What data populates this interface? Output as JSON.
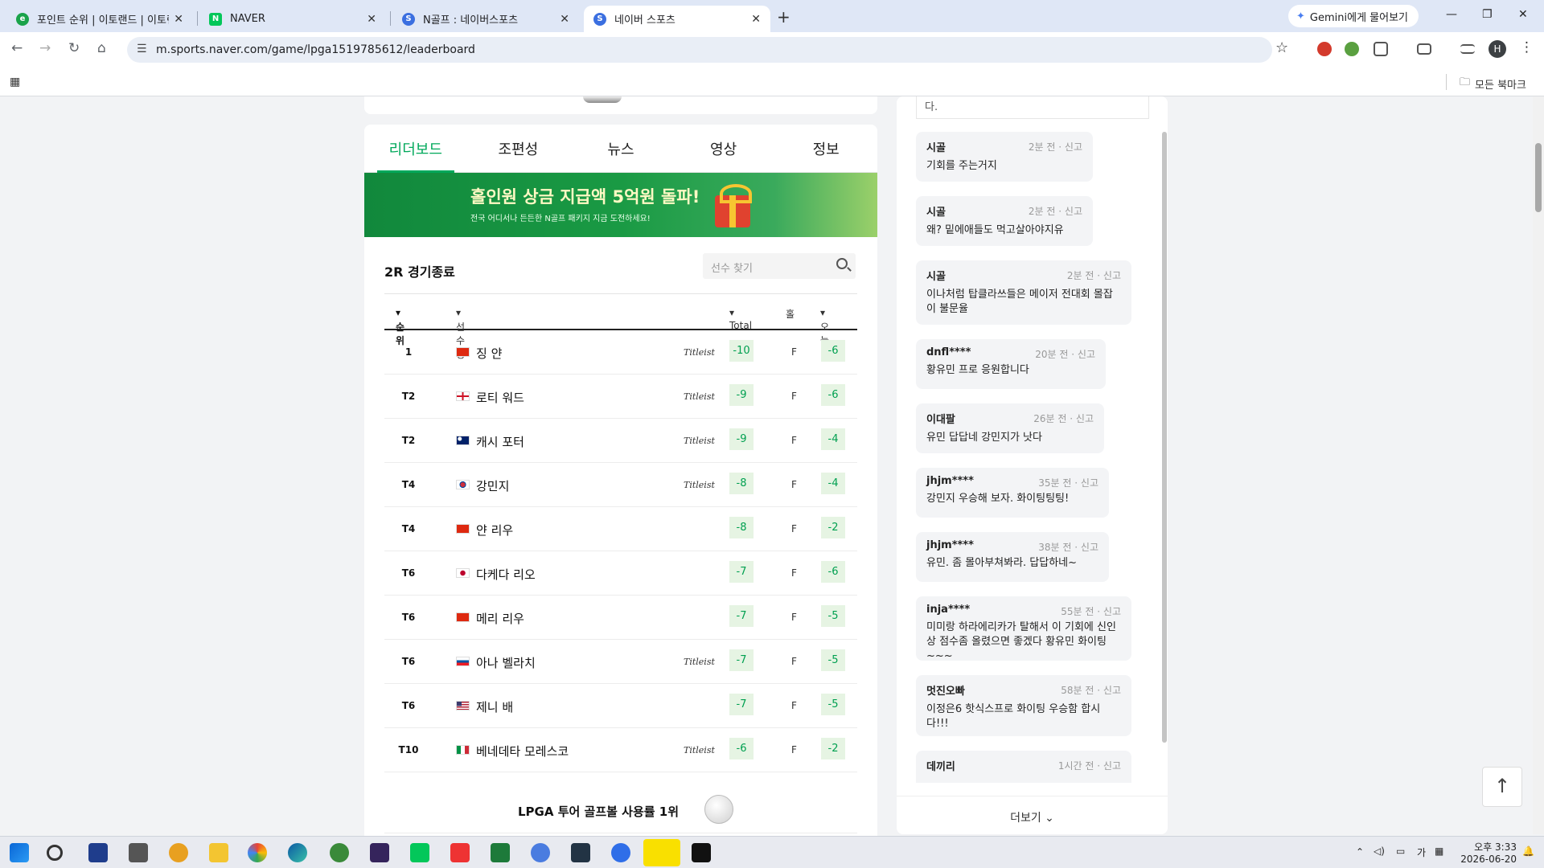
{
  "browser": {
    "tabs": [
      {
        "title": "포인트 순위 | 이토랜드 | 이토랜",
        "active": false,
        "color": "#1aa34a",
        "glyph": "e"
      },
      {
        "title": "NAVER",
        "active": false,
        "color": "#03c75a",
        "glyph": "N"
      },
      {
        "title": "N골프 : 네이버스포츠",
        "active": false,
        "color": "#3b6fe0",
        "glyph": "S"
      },
      {
        "title": "네이버 스포츠",
        "active": true,
        "color": "#3b6fe0",
        "glyph": "S"
      }
    ],
    "gemini": "Gemini에게 물어보기",
    "url": "m.sports.naver.com/game/lpga1519785612/leaderboard",
    "bookmarks_label": "모든 북마크",
    "profile_initial": "H"
  },
  "leaderboard": {
    "tabs": [
      "리더보드",
      "조편성",
      "뉴스",
      "영상",
      "정보"
    ],
    "active_tab": 0,
    "banner_title": "홀인원 상금 지급액 5억원 돌파!",
    "banner_sub": "전국 어디서나 든든한 N골프 패키지 지금 도전하세요!",
    "status": "2R 경기종료",
    "search_placeholder": "선수 찾기",
    "columns": {
      "rank": "순위",
      "player": "선수명",
      "total": "Total",
      "hole": "홀",
      "today": "오늘"
    },
    "rows": [
      {
        "rank": "1",
        "name": "징 얀",
        "flag": "cn",
        "brand": "Titleist",
        "total": "-10",
        "hole": "F",
        "today": "-6"
      },
      {
        "rank": "T2",
        "name": "로티 워드",
        "flag": "en",
        "brand": "Titleist",
        "total": "-9",
        "hole": "F",
        "today": "-6"
      },
      {
        "rank": "T2",
        "name": "캐시 포터",
        "flag": "au",
        "brand": "Titleist",
        "total": "-9",
        "hole": "F",
        "today": "-4"
      },
      {
        "rank": "T4",
        "name": "강민지",
        "flag": "kr",
        "brand": "Titleist",
        "total": "-8",
        "hole": "F",
        "today": "-4"
      },
      {
        "rank": "T4",
        "name": "얀 리우",
        "flag": "cn",
        "brand": "",
        "total": "-8",
        "hole": "F",
        "today": "-2"
      },
      {
        "rank": "T6",
        "name": "다케다 리오",
        "flag": "jp",
        "brand": "",
        "total": "-7",
        "hole": "F",
        "today": "-6"
      },
      {
        "rank": "T6",
        "name": "메리 리우",
        "flag": "cn",
        "brand": "",
        "total": "-7",
        "hole": "F",
        "today": "-5"
      },
      {
        "rank": "T6",
        "name": "아나 벨라치",
        "flag": "si",
        "brand": "Titleist",
        "total": "-7",
        "hole": "F",
        "today": "-5"
      },
      {
        "rank": "T6",
        "name": "제니 배",
        "flag": "us",
        "brand": "",
        "total": "-7",
        "hole": "F",
        "today": "-5"
      },
      {
        "rank": "T10",
        "name": "베네데타 모레스코",
        "flag": "it",
        "brand": "Titleist",
        "total": "-6",
        "hole": "F",
        "today": "-2"
      }
    ],
    "ad_text": "LPGA 투어 골프볼 사용률 1위"
  },
  "comments": {
    "top_fragment": "다.",
    "items": [
      {
        "user": "시골",
        "time": "2분 전",
        "report": "신고",
        "text": "기회를 주는거지"
      },
      {
        "user": "시골",
        "time": "2분 전",
        "report": "신고",
        "text": "왜? 밑에애들도 먹고살아야지유"
      },
      {
        "user": "시골",
        "time": "2분 전",
        "report": "신고",
        "text": "이나처럼 탑클라쓰들은 메이저 전대회 몰잡이 불문율"
      },
      {
        "user": "dnfl****",
        "time": "20분 전",
        "report": "신고",
        "text": "황유민 프로 응원합니다"
      },
      {
        "user": "이대팔",
        "time": "26분 전",
        "report": "신고",
        "text": "유민 답답네 강민지가 낫다"
      },
      {
        "user": "jhjm****",
        "time": "35분 전",
        "report": "신고",
        "text": "강민지 우승해 보자. 화이팅팅팅!"
      },
      {
        "user": "jhjm****",
        "time": "38분 전",
        "report": "신고",
        "text": "유민. 좀 몰아부쳐봐라. 답답하네~"
      },
      {
        "user": "inja****",
        "time": "55분 전",
        "report": "신고",
        "text": "미미랑 하라에리카가 탈해서 이 기회에 신인상 점수좀 올렸으면 좋겠다 황유민 화이팅~~~"
      },
      {
        "user": "멋진오빠",
        "time": "58분 전",
        "report": "신고",
        "text": "이정은6 핫식스프로 화이팅 우승함 합시다!!!"
      },
      {
        "user": "데끼리",
        "time": "1시간 전",
        "report": "신고",
        "text": ""
      }
    ],
    "more_label": "더보기"
  },
  "taskbar": {
    "time": "오후 3:33",
    "date": "2026-06-20",
    "ime": "가"
  }
}
